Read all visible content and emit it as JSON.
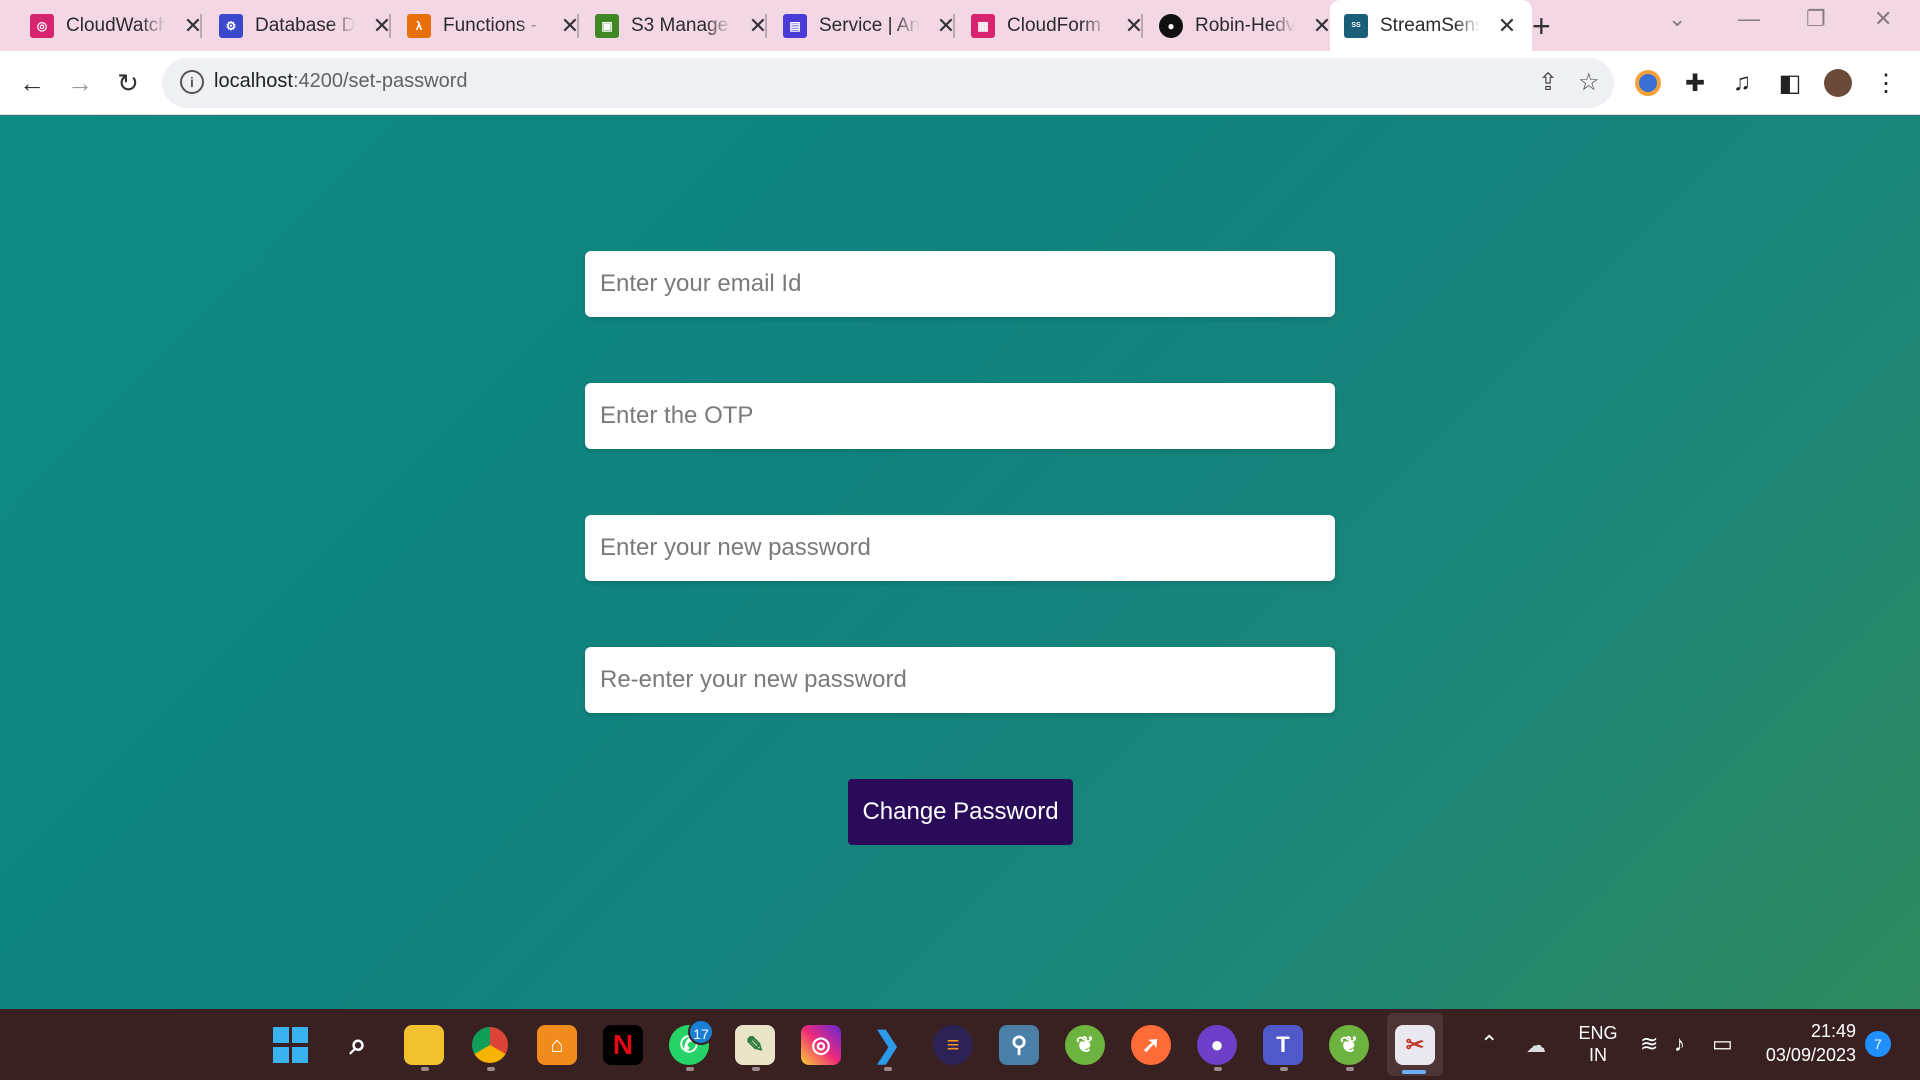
{
  "browser": {
    "tabs": [
      {
        "title": "CloudWatch",
        "icon": "cloudwatch-icon",
        "color": "#d6246e"
      },
      {
        "title": "Database D",
        "icon": "database-icon",
        "color": "#3b48cc"
      },
      {
        "title": "Functions -",
        "icon": "lambda-icon",
        "color": "#e8700a"
      },
      {
        "title": "S3 Manage",
        "icon": "s3-icon",
        "color": "#3f8624"
      },
      {
        "title": "Service | An",
        "icon": "service-icon",
        "color": "#4a3bd6"
      },
      {
        "title": "CloudForm",
        "icon": "cloudformation-icon",
        "color": "#d6246e"
      },
      {
        "title": "Robin-Hedv",
        "icon": "github-icon",
        "color": "#111111"
      },
      {
        "title": "StreamSens",
        "icon": "streamsense-icon",
        "color": "#1a5e7a"
      }
    ],
    "active_tab_index": 7,
    "url_host": "localhost",
    "url_path": ":4200/set-password"
  },
  "form": {
    "email_placeholder": "Enter your email Id",
    "otp_placeholder": "Enter the OTP",
    "new_password_placeholder": "Enter your new password",
    "confirm_password_placeholder": "Re-enter your new password",
    "submit_label": "Change Password"
  },
  "taskbar": {
    "whatsapp_badge": "17",
    "language": "ENG",
    "region": "IN",
    "time": "21:49",
    "date": "03/09/2023",
    "notification_count": "7"
  },
  "colors": {
    "accent": "#2a0b5a",
    "page_bg": "#0d8a84",
    "tab_strip": "#f3d7e5",
    "taskbar": "#3a2121"
  }
}
